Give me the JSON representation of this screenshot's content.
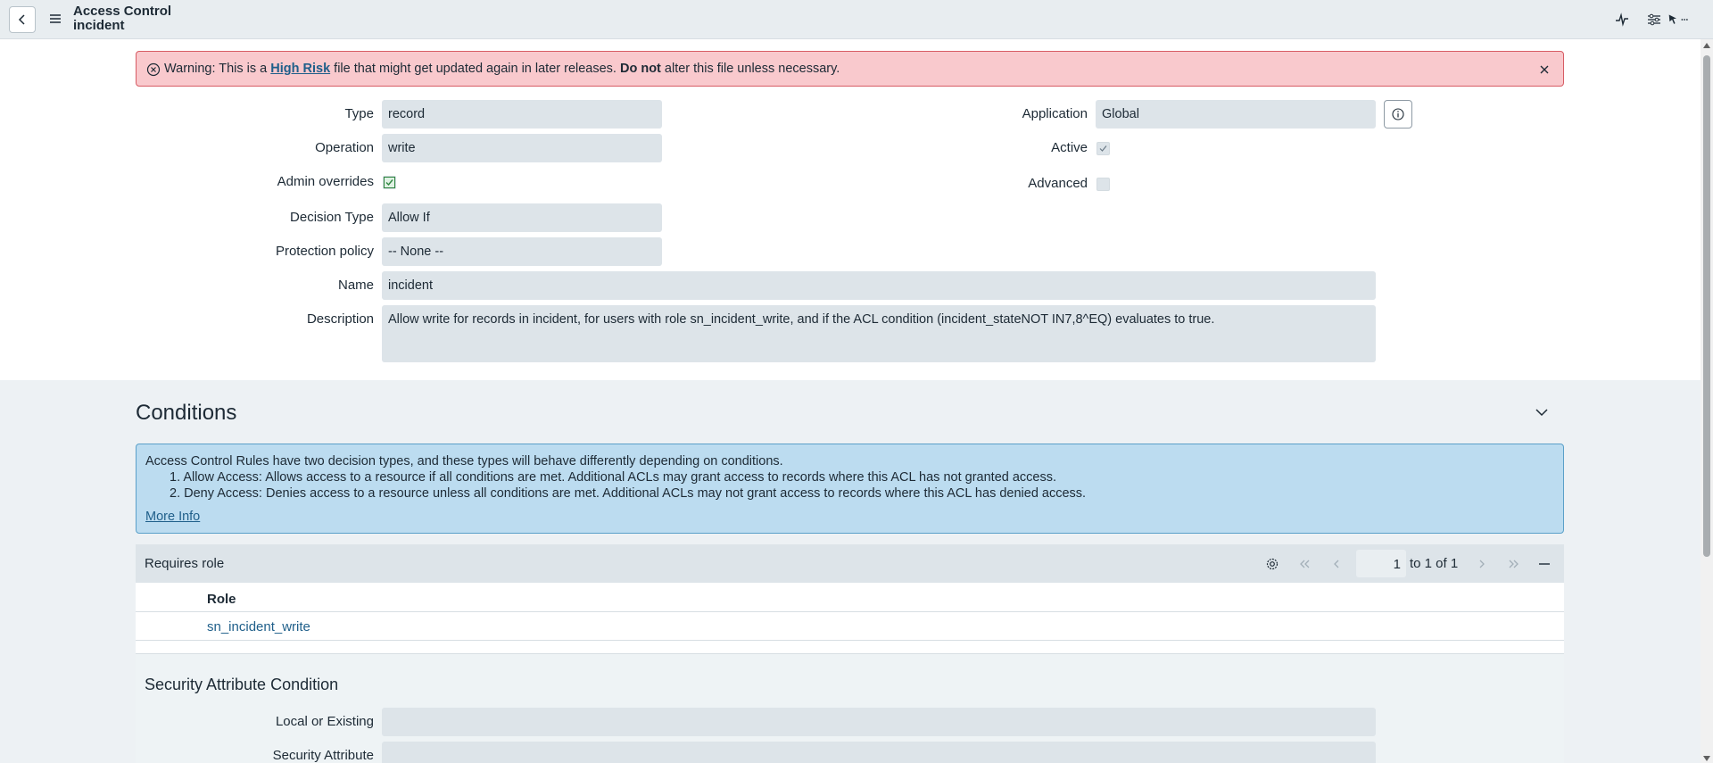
{
  "header": {
    "title_line1": "Access Control",
    "title_line2": "incident",
    "icons": [
      "back-icon",
      "menu-icon",
      "activity-icon",
      "sliders-icon",
      "pointer-icon",
      "more-icon"
    ]
  },
  "warning": {
    "prefix": "Warning: This is a ",
    "link": "High Risk",
    "middle": " file that might get updated again in later releases. ",
    "bold": "Do not",
    "suffix": " alter this file unless necessary."
  },
  "form": {
    "type_label": "Type",
    "type_value": "record",
    "operation_label": "Operation",
    "operation_value": "write",
    "admin_overrides_label": "Admin overrides",
    "admin_overrides_checked": true,
    "decision_type_label": "Decision Type",
    "decision_type_value": "Allow If",
    "protection_policy_label": "Protection policy",
    "protection_policy_value": "-- None --",
    "name_label": "Name",
    "name_value": "incident",
    "description_label": "Description",
    "description_value": "Allow write for records in incident, for users with role sn_incident_write, and if the ACL condition (incident_stateNOT IN7,8^EQ) evaluates to true.",
    "application_label": "Application",
    "application_value": "Global",
    "active_label": "Active",
    "active_checked": true,
    "advanced_label": "Advanced",
    "advanced_checked": false
  },
  "conditions": {
    "title": "Conditions",
    "info_intro": "Access Control Rules have two decision types, and these types will behave differently depending on conditions.",
    "info_item1": "1. Allow Access: Allows access to a resource if all conditions are met. Additional ACLs may grant access to records where this ACL has not granted access.",
    "info_item2": "2. Deny Access: Denies access to a resource unless all conditions are met. Additional ACLs may not grant access to records where this ACL has denied access.",
    "more_info": "More Info"
  },
  "related_list": {
    "title": "Requires role",
    "page_value": "1",
    "page_of": "to 1 of 1",
    "column_header": "Role",
    "rows": [
      "sn_incident_write"
    ]
  },
  "security_attribute": {
    "title": "Security Attribute Condition",
    "local_label": "Local or Existing",
    "local_value": "",
    "attribute_label": "Security Attribute",
    "attribute_value": ""
  },
  "colors": {
    "warning_bg": "#f9c9cd",
    "info_bg": "#bcdcf0",
    "link": "#1f5f8a",
    "field_bg": "#dde4e9",
    "check_green": "#2e8540"
  }
}
